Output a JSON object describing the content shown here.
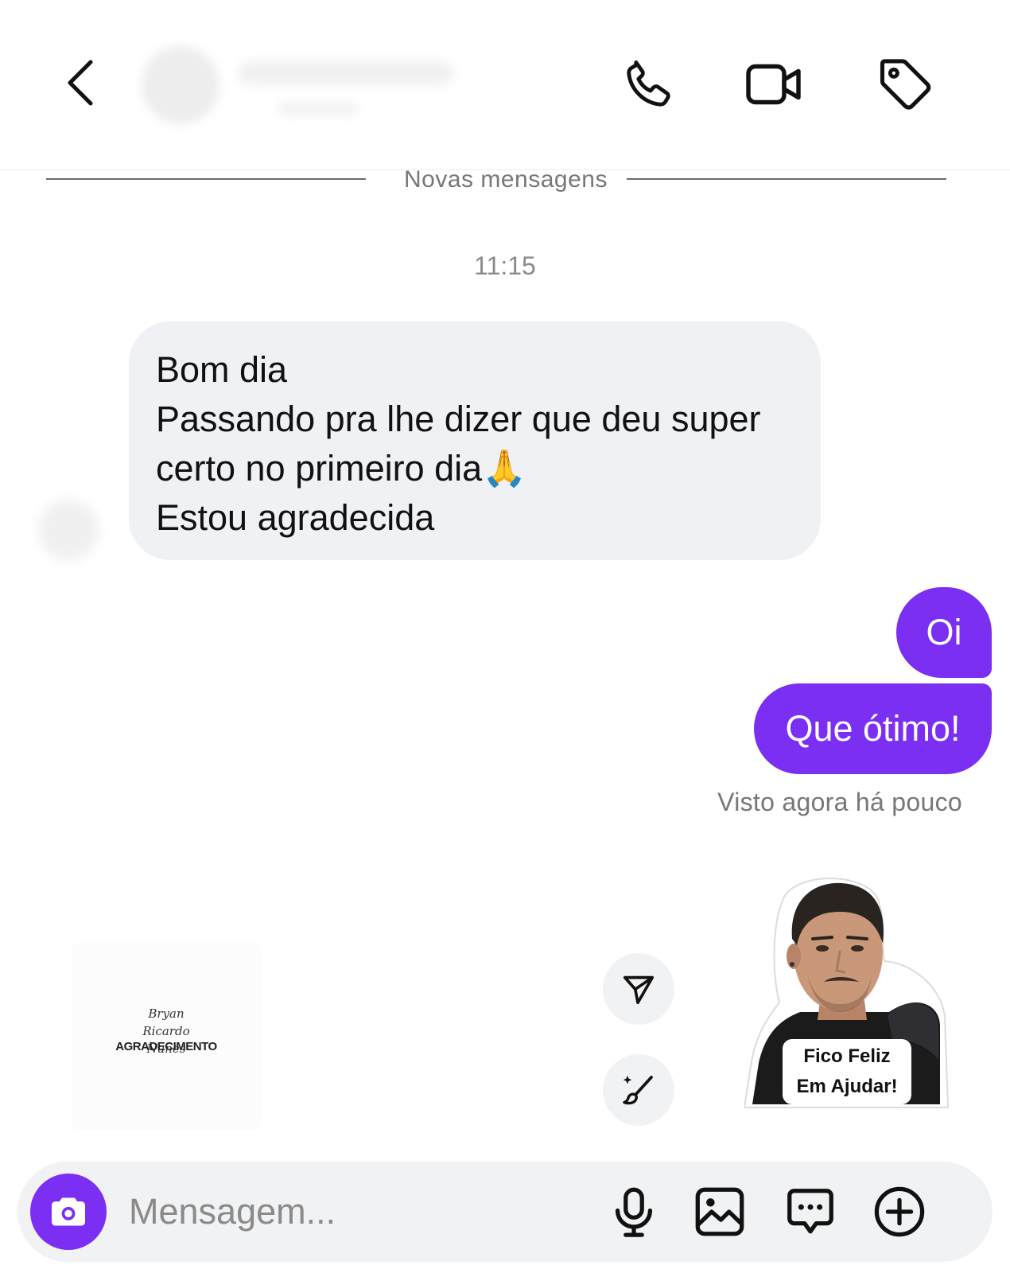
{
  "header": {
    "back_icon": "chevron-left-icon",
    "actions": [
      "phone-icon",
      "video-camera-icon",
      "tag-icon"
    ]
  },
  "divider": {
    "label": "Novas mensagens"
  },
  "conversation": {
    "timestamp": "11:15",
    "received": {
      "lines": [
        "Bom dia",
        "Passando pra lhe dizer que deu super",
        "certo no primeiro dia🙏",
        "Estou agradecida"
      ]
    },
    "sent": [
      "Oi",
      "Que ótimo!"
    ],
    "seen_status": "Visto agora há pouco"
  },
  "stickers": {
    "left": {
      "signature": "Bryan Ricardo Nunes",
      "title": "AGRADECIMENTO"
    },
    "right": {
      "caption_line1": "Fico Feliz",
      "caption_line2": "Em Ajudar!"
    },
    "side_buttons": [
      "send-icon",
      "magic-brush-icon"
    ]
  },
  "composer": {
    "placeholder": "Mensagem...",
    "icons": [
      "camera-icon",
      "microphone-icon",
      "gallery-icon",
      "chat-bubble-icon",
      "plus-circle-icon"
    ]
  },
  "colors": {
    "accent": "#7a2ff2",
    "incoming_bubble": "#eff1f4",
    "muted_text": "#777777"
  }
}
